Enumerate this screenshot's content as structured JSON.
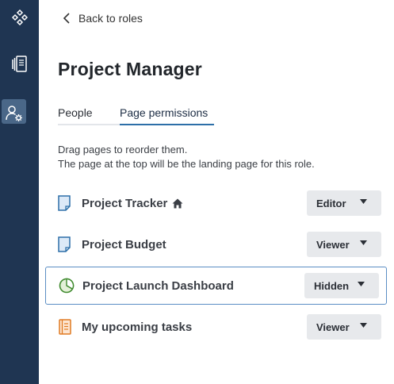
{
  "nav": {
    "back_label": "Back to roles"
  },
  "role": {
    "title": "Project Manager"
  },
  "tabs": [
    {
      "label": "People"
    },
    {
      "label": "Page permissions"
    }
  ],
  "instructions": {
    "line1": "Drag pages to reorder them.",
    "line2": "The page at the top will be the landing page for this role."
  },
  "pages": [
    {
      "name": "Project Tracker",
      "permission": "Editor",
      "icon": "document-icon",
      "landing": true
    },
    {
      "name": "Project Budget",
      "permission": "Viewer",
      "icon": "document-icon"
    },
    {
      "name": "Project Launch Dashboard",
      "permission": "Hidden",
      "icon": "pie-chart-icon"
    },
    {
      "name": "My upcoming tasks",
      "permission": "Viewer",
      "icon": "notebook-icon"
    }
  ],
  "colors": {
    "sidebar": "#1f3552",
    "accent": "#2d6fa8",
    "highlight_border": "#5b8ec4"
  }
}
